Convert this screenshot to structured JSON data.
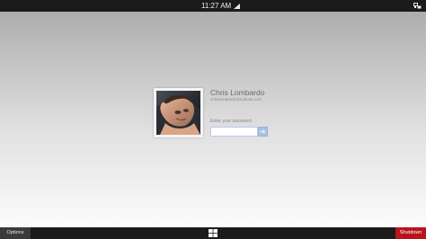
{
  "status_bar": {
    "time": "11:27 AM",
    "signal_icon": "signal-strength-icon",
    "network_icon": "network-icon"
  },
  "login": {
    "user_name": "Chris Lombardo",
    "user_email": "chrislombardo@outlook.com",
    "password_label": "Enter your password",
    "password_value": "",
    "submit_icon": "arrow-right-icon",
    "avatar_icon": "user-photo"
  },
  "taskbar": {
    "options_label": "Options",
    "start_icon": "windows-logo-icon",
    "shutdown_label": "Shutdown"
  },
  "colors": {
    "top_bar": "#1b1b1b",
    "bottom_bar": "#1c1c1c",
    "options_button": "#3a3a3a",
    "shutdown_button": "#b8151b",
    "submit_button": "#a9c0e4"
  }
}
